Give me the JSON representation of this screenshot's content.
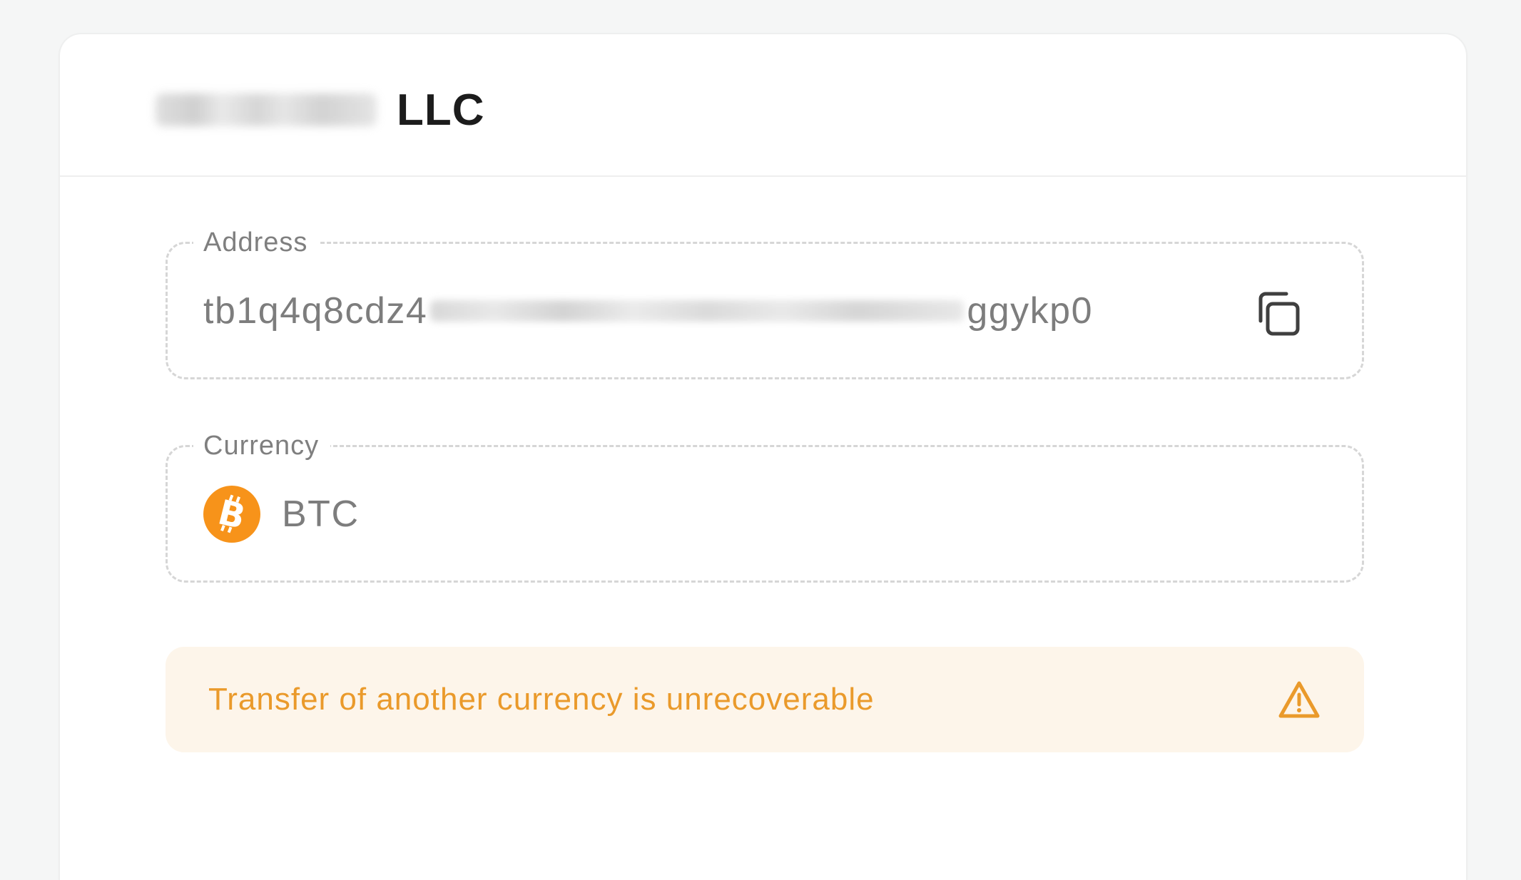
{
  "header": {
    "title_suffix": "LLC"
  },
  "address_field": {
    "label": "Address",
    "value_start": "tb1q4q8cdz4",
    "value_end": "ggykp0",
    "copy_icon": "copy-icon"
  },
  "currency_field": {
    "label": "Currency",
    "code": "BTC",
    "icon": "bitcoin-icon"
  },
  "warning": {
    "text": "Transfer of another currency is unrecoverable",
    "icon": "warning-triangle-icon"
  },
  "colors": {
    "bitcoin_orange": "#f7931a",
    "warning_text": "#ea9a2b",
    "warning_bg": "#fdf5ea"
  }
}
